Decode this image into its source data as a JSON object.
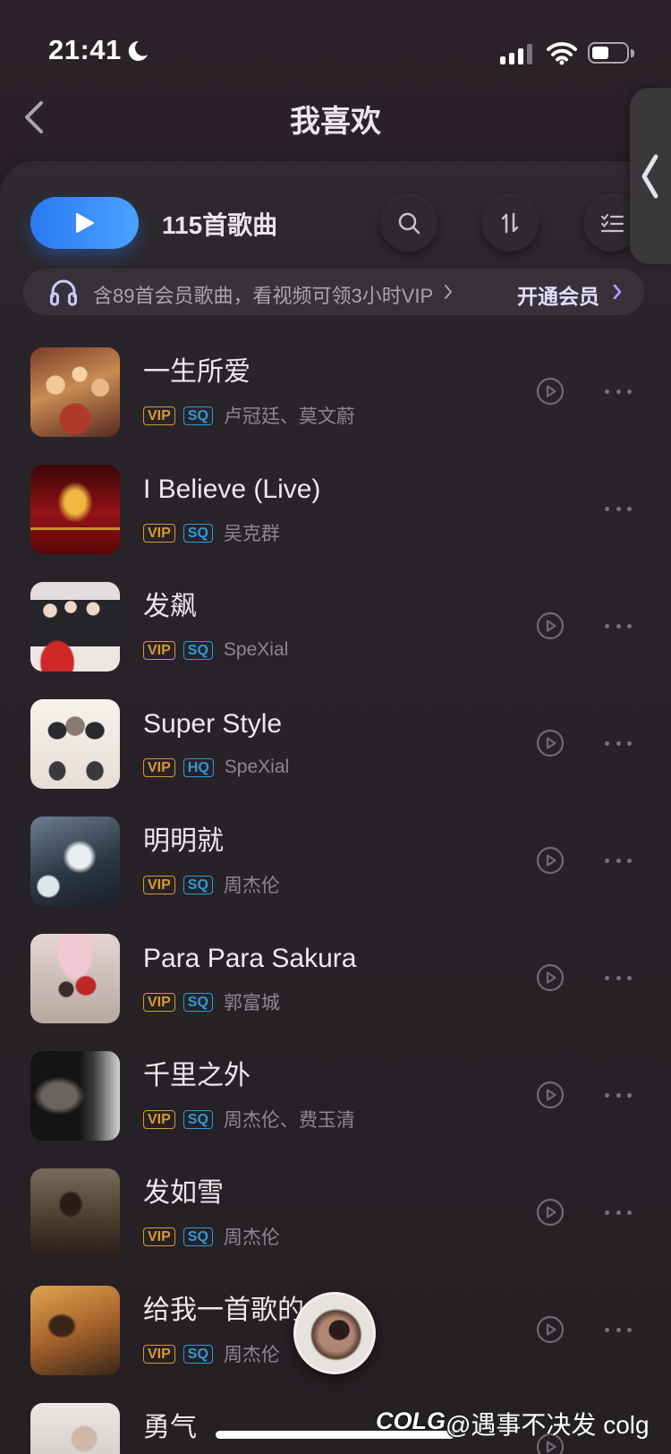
{
  "status_bar": {
    "time": "21:41",
    "icons": [
      "moon-icon",
      "signal-icon",
      "wifi-icon",
      "battery-icon"
    ]
  },
  "header": {
    "title": "我喜欢",
    "back_icon": "chevron-left-icon",
    "side_tab_icon": "chevron-left-icon"
  },
  "toolbar": {
    "play_all_icon": "play-icon",
    "song_count": "115首歌曲",
    "search_icon": "search-icon",
    "sort_icon": "sort-icon",
    "multi_select_icon": "checklist-icon"
  },
  "vip_banner": {
    "icon": "headphones-icon",
    "text": "含89首会员歌曲，看视频可领3小时VIP",
    "cta": "开通会员"
  },
  "songs": [
    {
      "title": "一生所爱",
      "badges": [
        "VIP",
        "SQ"
      ],
      "artist": "卢冠廷、莫文蔚",
      "has_video": true
    },
    {
      "title": "I Believe (Live)",
      "badges": [
        "VIP",
        "SQ"
      ],
      "artist": "吴克群",
      "has_video": false
    },
    {
      "title": "发飙",
      "badges": [
        "VIP",
        "SQ"
      ],
      "artist": "SpeXial",
      "has_video": true
    },
    {
      "title": "Super Style",
      "badges": [
        "VIP",
        "HQ"
      ],
      "artist": "SpeXial",
      "has_video": true
    },
    {
      "title": "明明就",
      "badges": [
        "VIP",
        "SQ"
      ],
      "artist": "周杰伦",
      "has_video": true
    },
    {
      "title": "Para Para Sakura",
      "badges": [
        "VIP",
        "SQ"
      ],
      "artist": "郭富城",
      "has_video": true
    },
    {
      "title": "千里之外",
      "badges": [
        "VIP",
        "SQ"
      ],
      "artist": "周杰伦、费玉清",
      "has_video": true
    },
    {
      "title": "发如雪",
      "badges": [
        "VIP",
        "SQ"
      ],
      "artist": "周杰伦",
      "has_video": true
    },
    {
      "title": "给我一首歌的",
      "badges": [
        "VIP",
        "SQ"
      ],
      "artist": "周杰伦",
      "has_video": true
    },
    {
      "title": "勇气",
      "has_video": true
    }
  ],
  "mini_player": {
    "icon": "now-playing-disc"
  },
  "watermark": {
    "logo": "COLG",
    "text": "@遇事不决发 colg"
  },
  "colors": {
    "accent_blue": "#3a8cff",
    "vip_gold": "#d99a2b",
    "quality_blue": "#2f9bd8",
    "vip_cta": "#e3deff",
    "background": "#262126"
  }
}
